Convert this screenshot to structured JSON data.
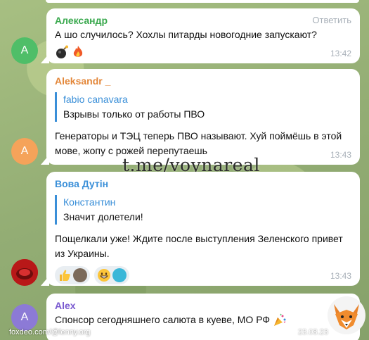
{
  "colors": {
    "avatar_green": "#4fbe68",
    "avatar_orange": "#f5a35a",
    "avatar_purple": "#8c7ad6",
    "name_green": "#3aa94e",
    "name_orange": "#e3873a",
    "name_blue": "#3a8fd8",
    "name_purple": "#7a5ad0"
  },
  "messages": [
    {
      "avatar_letter": "A",
      "sender": "Александр",
      "reply_label": "Ответить",
      "text": "А шо случилось? Хохлы питарды новогодние запускают?",
      "emojis": [
        "bomb-icon",
        "fire-icon"
      ],
      "time": "13:42"
    },
    {
      "avatar_letter": "A",
      "sender": "Aleksandr _",
      "quote_sender": "fabio canavara",
      "quote_text": "Взрывы только от работы ПВО",
      "text": "Генераторы и ТЭЦ теперь ПВО называют. Хуй поймёшь в этой мове, жопу с рожей перепутаешь",
      "time": "13:43"
    },
    {
      "sender": "Вова Дутін",
      "quote_sender": "Константин",
      "quote_text": "Значит долетели!",
      "text": "Пощелкали уже! Ждите после выступления Зеленского привет из Украины.",
      "reactions": [
        {
          "icon": "thumbs-up-icon"
        },
        {
          "icon": "grinning-face-icon"
        }
      ],
      "time": "13:43"
    },
    {
      "avatar_letter": "A",
      "sender": "Alex",
      "text": "Спонсор сегодняшнего салюта в куеве, МО РФ",
      "emoji": "party-popper-icon"
    }
  ],
  "watermark": "t.me/voynareal",
  "source_caption": "foxdeo.com/@lenny.org",
  "bottom_time": "23.08.23"
}
